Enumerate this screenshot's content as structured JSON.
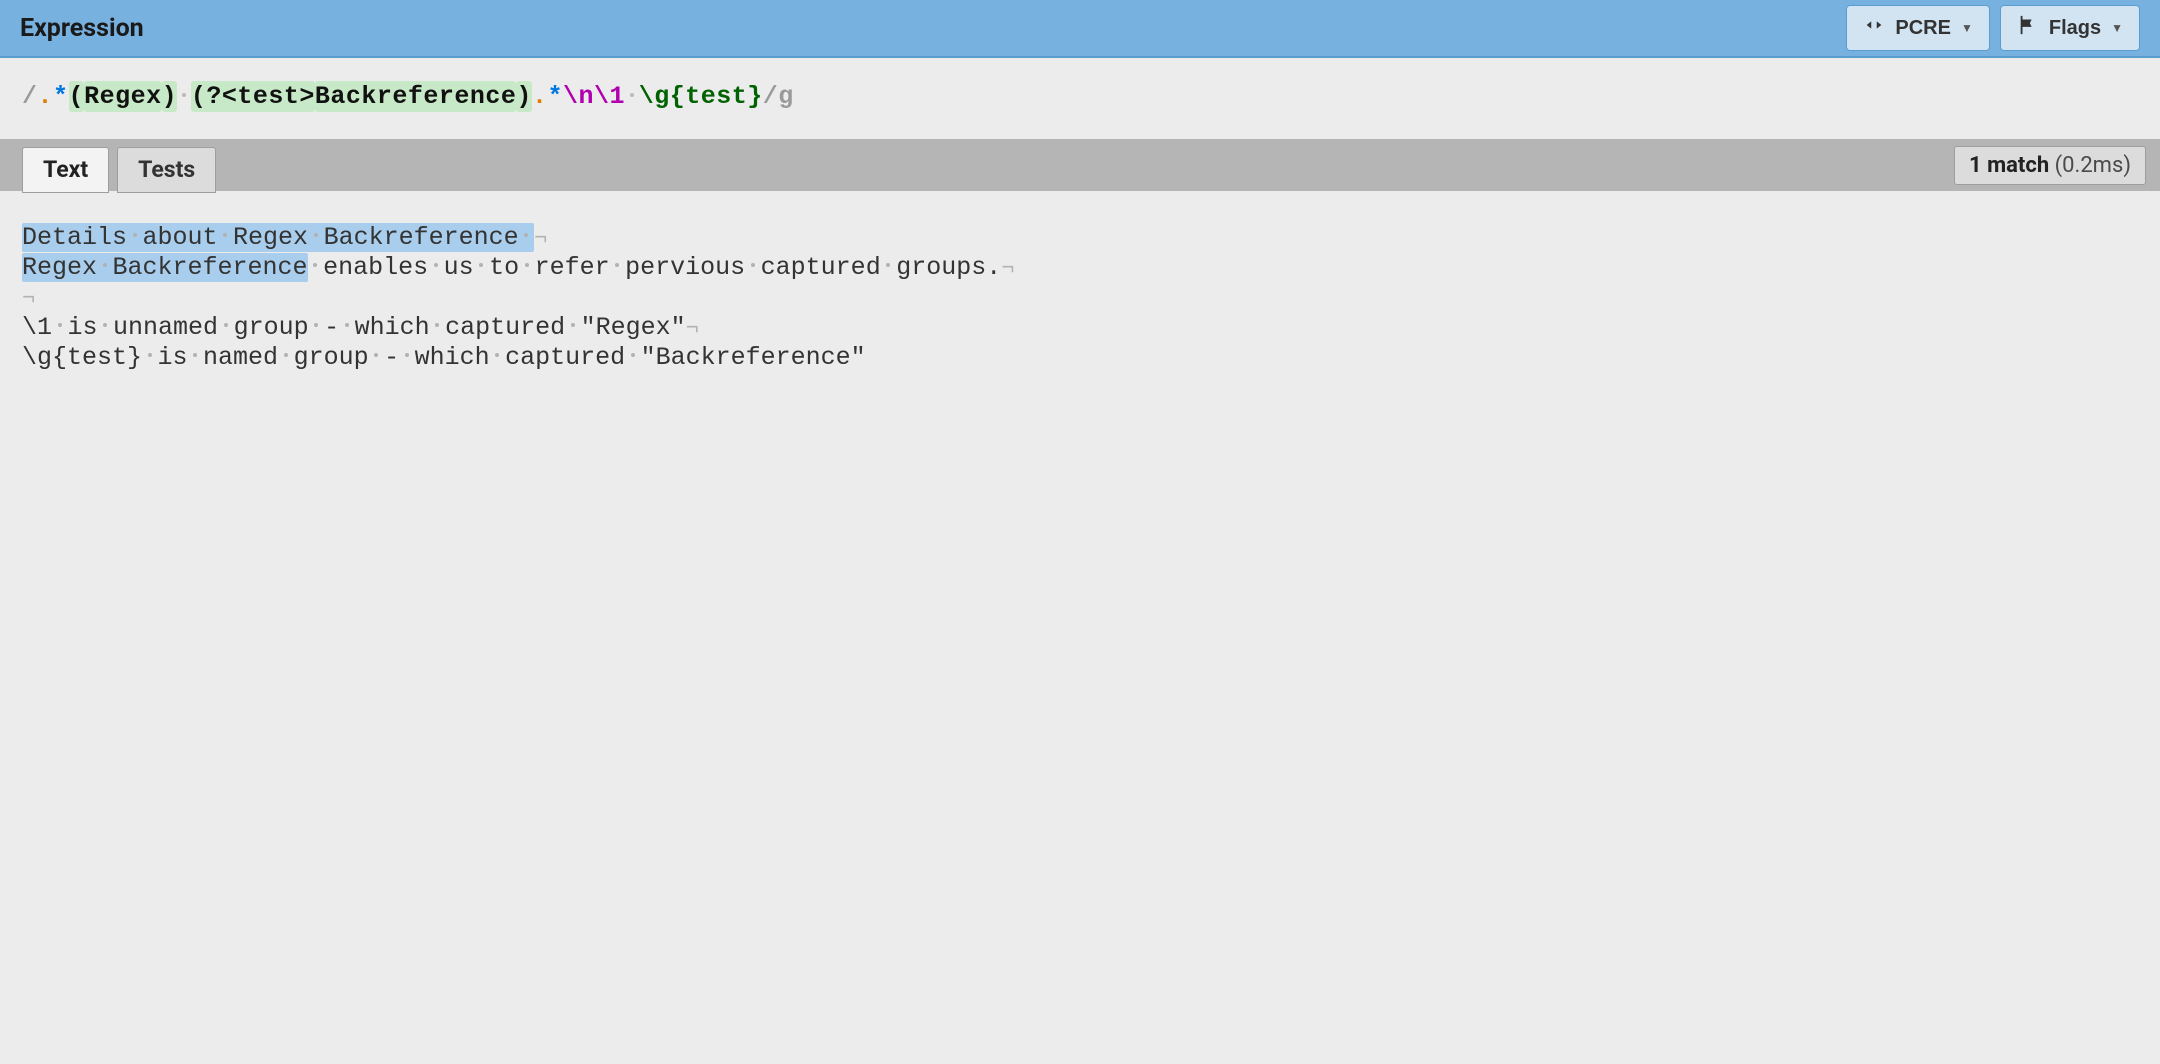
{
  "header": {
    "title": "Expression",
    "engine_button": "PCRE",
    "flags_button": "Flags"
  },
  "expression": {
    "slash_open": "/",
    "dot1": ".",
    "star1": "*",
    "group1_open": "(",
    "group1_text": "Regex",
    "group1_close": ")",
    "group2_open": "(?<test>",
    "group2_text": "Backreference",
    "group2_close": ")",
    "dot2": ".",
    "star2": "*",
    "esc_n": "\\n",
    "backref1": "\\1",
    "backref_named": "\\g{test}",
    "slash_close": "/",
    "flags": "g"
  },
  "tabs": {
    "text": "Text",
    "tests": "Tests"
  },
  "status": {
    "match_count": "1 match",
    "timing": "(0.2ms)"
  },
  "text_content": {
    "line1": {
      "words": [
        "Details",
        "about",
        "Regex",
        "Backreference"
      ],
      "highlight": "full"
    },
    "line2": {
      "match_words": [
        "Regex",
        "Backreference"
      ],
      "rest_words": [
        "enables",
        "us",
        "to",
        "refer",
        "pervious",
        "captured",
        "groups."
      ]
    },
    "line3_empty": true,
    "line4": {
      "words": [
        "\\1",
        "is",
        "unnamed",
        "group",
        "-",
        "which",
        "captured",
        "\"Regex\""
      ]
    },
    "line5": {
      "words": [
        "\\g{test}",
        "is",
        "named",
        "group",
        "-",
        "which",
        "captured",
        "\"Backreference\""
      ]
    }
  }
}
